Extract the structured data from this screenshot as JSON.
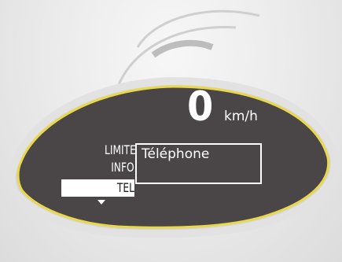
{
  "display": {
    "speed_value": "0",
    "speed_unit": "km/h",
    "menu": {
      "items": [
        {
          "label": "LIMITE"
        },
        {
          "label": "INFO"
        },
        {
          "label": "TEL",
          "selected": true
        }
      ],
      "more_indicator": "arrow-down-icon"
    },
    "submenu": {
      "label": "Téléphone"
    }
  },
  "colors": {
    "screen_bg": "#4a4648",
    "bezel_outline": "#e8d84a",
    "text": "#ffffff",
    "selection_bg": "#ffffff",
    "selection_text": "#1e1e1e"
  }
}
